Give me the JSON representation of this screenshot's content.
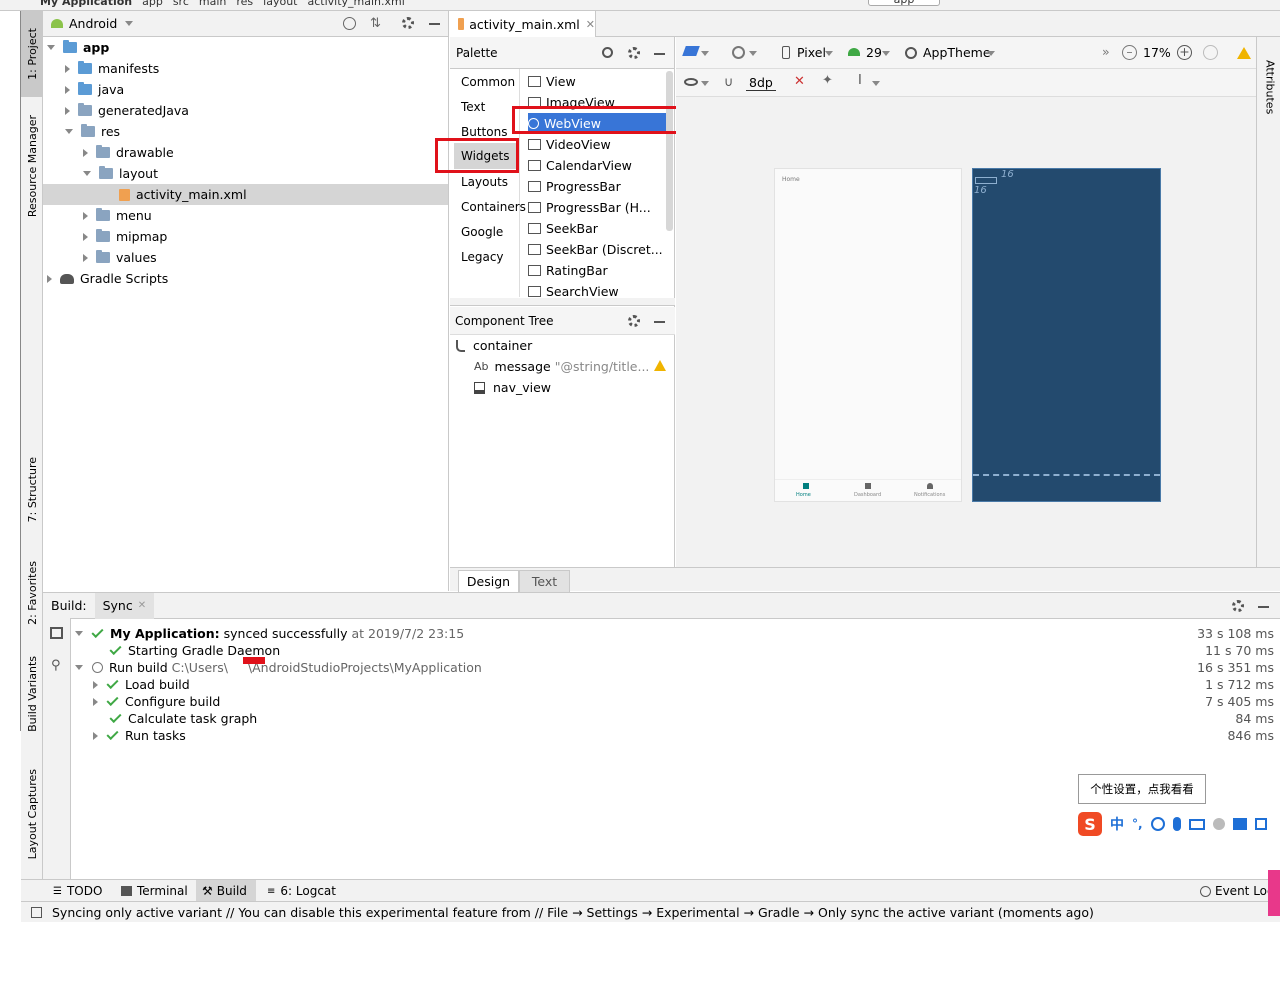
{
  "breadcrumb": [
    "My Application",
    "app",
    "src",
    "main",
    "res",
    "layout",
    "activity_main.xml"
  ],
  "breadcrumb_run_config": "app",
  "left_strip": {
    "project_tab": "1: Project",
    "resource_manager_tab": "Resource Manager",
    "structure_tab": "7: Structure",
    "favorites_tab": "2: Favorites",
    "build_variants_tab": "Build Variants",
    "layout_captures_tab": "Layout Captures"
  },
  "project": {
    "view_mode": "Android",
    "tree": [
      {
        "label": "app",
        "indent": 0,
        "expanded": true,
        "bold": true
      },
      {
        "label": "manifests",
        "indent": 1,
        "expanded": false
      },
      {
        "label": "java",
        "indent": 1,
        "expanded": false
      },
      {
        "label": "generatedJava",
        "indent": 1,
        "expanded": false
      },
      {
        "label": "res",
        "indent": 1,
        "expanded": true
      },
      {
        "label": "drawable",
        "indent": 2,
        "expanded": false
      },
      {
        "label": "layout",
        "indent": 2,
        "expanded": true
      },
      {
        "label": "activity_main.xml",
        "indent": 3,
        "selected": true
      },
      {
        "label": "menu",
        "indent": 2,
        "expanded": false
      },
      {
        "label": "mipmap",
        "indent": 2,
        "expanded": false
      },
      {
        "label": "values",
        "indent": 2,
        "expanded": false
      },
      {
        "label": "Gradle Scripts",
        "indent": 0,
        "expanded": false
      }
    ]
  },
  "editor": {
    "file_tab": "activity_main.xml",
    "palette": {
      "title": "Palette",
      "categories": [
        "Common",
        "Text",
        "Buttons",
        "Widgets",
        "Layouts",
        "Containers",
        "Google",
        "Legacy"
      ],
      "selected_category": "Widgets",
      "widgets": [
        "View",
        "ImageView",
        "WebView",
        "VideoView",
        "CalendarView",
        "ProgressBar",
        "ProgressBar (H...",
        "SeekBar",
        "SeekBar (Discret...",
        "RatingBar",
        "SearchView"
      ],
      "selected_widget": "WebView"
    },
    "component_tree": {
      "title": "Component Tree",
      "items": [
        "container",
        "message",
        "nav_view"
      ],
      "message_prefix": "Ab",
      "message_hint": "\"@string/title..."
    },
    "design_toolbar": {
      "device": "Pixel",
      "api": "29",
      "theme": "AppTheme",
      "zoom": "17%",
      "margin": "8dp"
    },
    "preview": {
      "home_title": "Home",
      "nav_items": [
        "Home",
        "Dashboard",
        "Notifications"
      ],
      "blueprint_value": "16"
    },
    "attributes_tab": "Attributes",
    "view_tabs": [
      "Design",
      "Text"
    ],
    "active_view_tab": "Design"
  },
  "build": {
    "title": "Build:",
    "tab": "Sync",
    "lines": [
      {
        "bold": "My Application:",
        "text": " synced successfully",
        "gray": " at 2019/7/2 23:15",
        "duration": "33 s 108 ms",
        "indent": 0,
        "expander": "down",
        "icon": "check"
      },
      {
        "text": "Starting Gradle Daemon",
        "duration": "11 s 70 ms",
        "indent": 1,
        "icon": "check"
      },
      {
        "text": "Run build ",
        "gray": "C:\\Users\\     \\AndroidStudioProjects\\MyApplication",
        "duration": "16 s 351 ms",
        "indent": 0,
        "expander": "down",
        "icon": "running"
      },
      {
        "text": "Load build",
        "duration": "1 s 712 ms",
        "indent": 1,
        "expander": "right",
        "icon": "check"
      },
      {
        "text": "Configure build",
        "duration": "7 s 405 ms",
        "indent": 1,
        "expander": "right",
        "icon": "check"
      },
      {
        "text": "Calculate task graph",
        "duration": "84 ms",
        "indent": 1,
        "icon": "check"
      },
      {
        "text": "Run tasks",
        "duration": "846 ms",
        "indent": 1,
        "expander": "right",
        "icon": "check"
      }
    ]
  },
  "ime": {
    "tooltip": "个性设置，点我看看",
    "mode": "中"
  },
  "tool_windows": [
    "TODO",
    "Terminal",
    "Build",
    "6: Logcat"
  ],
  "event_log": "Event Log",
  "status_message": "Syncing only active variant // You can disable this experimental feature from // File → Settings → Experimental → Gradle → Only sync the active variant (moments ago)",
  "colors": {
    "accent": "#3875d7",
    "highlight": "#e0111a",
    "blueprint": "#234a6e",
    "success": "#3fa845"
  }
}
